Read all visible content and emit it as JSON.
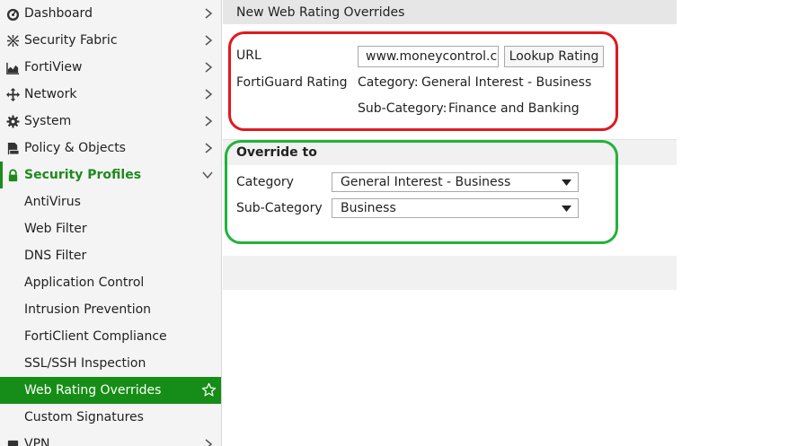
{
  "sidebar": {
    "items": [
      {
        "label": "Dashboard",
        "icon": "dashboard-gauge-icon"
      },
      {
        "label": "Security Fabric",
        "icon": "security-fabric-icon"
      },
      {
        "label": "FortiView",
        "icon": "fortiview-chart-icon"
      },
      {
        "label": "Network",
        "icon": "network-arrows-icon"
      },
      {
        "label": "System",
        "icon": "gear-icon"
      },
      {
        "label": "Policy & Objects",
        "icon": "policy-document-icon"
      },
      {
        "label": "Security Profiles",
        "icon": "lock-icon"
      }
    ],
    "sub_items": [
      {
        "label": "AntiVirus"
      },
      {
        "label": "Web Filter"
      },
      {
        "label": "DNS Filter"
      },
      {
        "label": "Application Control"
      },
      {
        "label": "Intrusion Prevention"
      },
      {
        "label": "FortiClient Compliance"
      },
      {
        "label": "SSL/SSH Inspection"
      },
      {
        "label": "Web Rating Overrides",
        "selected": true
      },
      {
        "label": "Custom Signatures"
      }
    ],
    "next_item": {
      "label": "VPN",
      "icon": "vpn-icon"
    }
  },
  "page": {
    "title": "New Web Rating Overrides"
  },
  "url_section": {
    "url_label": "URL",
    "url_value": "www.moneycontrol.c",
    "lookup_button": "Lookup Rating",
    "rating_label": "FortiGuard Rating",
    "category_prefix": "Category:",
    "category_value": "General Interest - Business",
    "subcategory_prefix": "Sub-Category:",
    "subcategory_value": "Finance and Banking"
  },
  "override_section": {
    "heading": "Override to",
    "category_label": "Category",
    "category_selected": "General Interest - Business",
    "subcategory_label": "Sub-Category",
    "subcategory_selected": "Business"
  },
  "colors": {
    "accent_green": "#168d16",
    "highlight_red": "#e0191f",
    "highlight_green": "#22b33a"
  }
}
